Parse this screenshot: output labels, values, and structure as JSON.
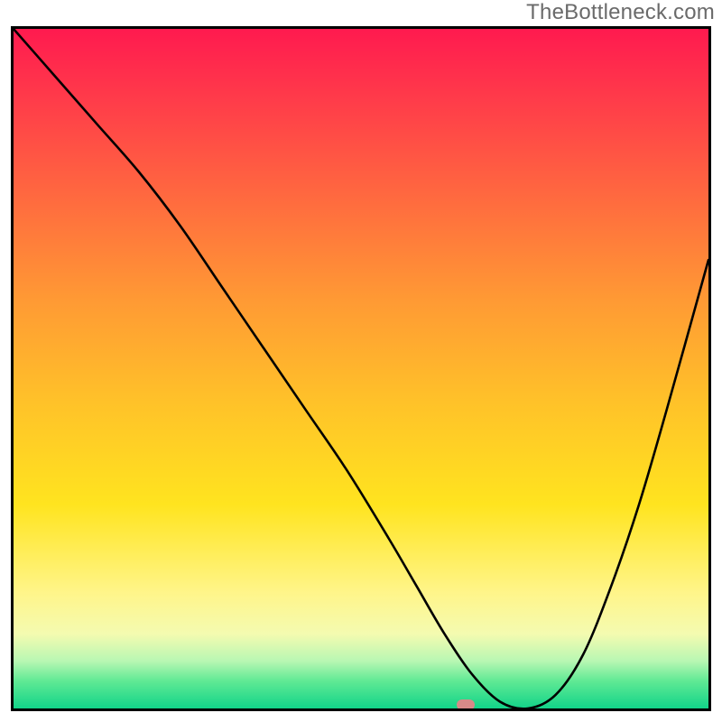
{
  "watermark": "TheBottleneck.com",
  "chart_data": {
    "type": "line",
    "title": "",
    "xlabel": "",
    "ylabel": "",
    "xlim": [
      0,
      100
    ],
    "ylim": [
      0,
      100
    ],
    "grid": false,
    "legend": false,
    "series": [
      {
        "name": "bottleneck-curve",
        "x": [
          0,
          6,
          12,
          18,
          24,
          30,
          36,
          42,
          48,
          54,
          58,
          62,
          66,
          70,
          74,
          78,
          82,
          86,
          90,
          94,
          100
        ],
        "y": [
          100,
          93,
          86,
          79,
          71,
          62,
          53,
          44,
          35,
          25,
          18,
          11,
          5,
          1,
          0,
          2,
          8,
          18,
          30,
          44,
          66
        ]
      }
    ],
    "marker": {
      "x": 65,
      "y": 0.5,
      "color": "#d88a88"
    },
    "background_gradient": {
      "direction": "vertical",
      "stops": [
        {
          "pos": 0.0,
          "color": "#ff1a4f"
        },
        {
          "pos": 0.25,
          "color": "#ff6a3f"
        },
        {
          "pos": 0.55,
          "color": "#ffc229"
        },
        {
          "pos": 0.83,
          "color": "#fff58a"
        },
        {
          "pos": 0.93,
          "color": "#b9f7b3"
        },
        {
          "pos": 1.0,
          "color": "#12d489"
        }
      ]
    }
  }
}
